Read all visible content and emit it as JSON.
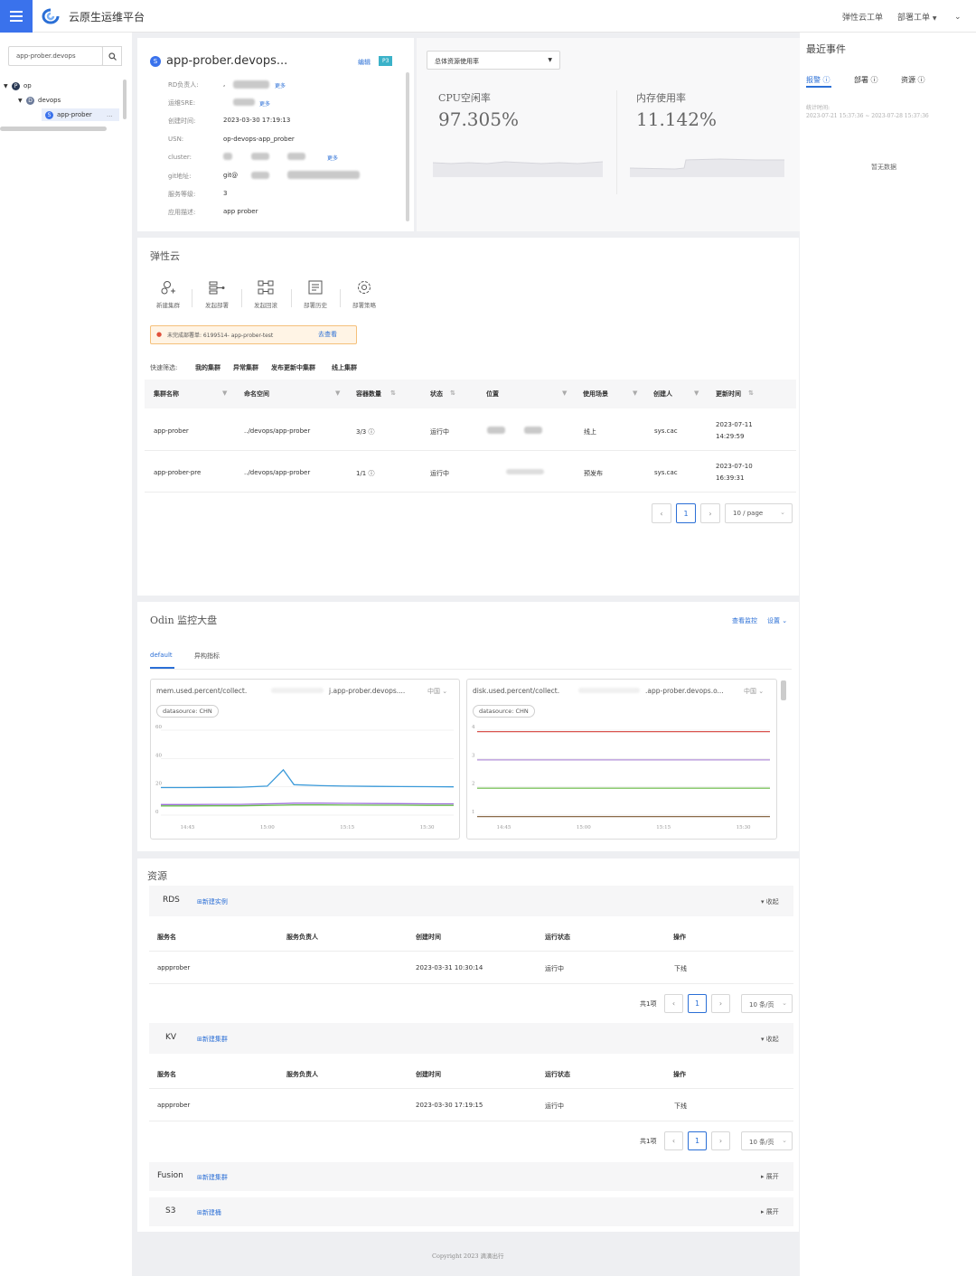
{
  "app": {
    "title": "云原生运维平台"
  },
  "topnav": {
    "elastic_ticket": "弹性云工单",
    "deploy_ticket": "部署工单"
  },
  "sidebar": {
    "search_value": "app-prober.devops",
    "tree": [
      {
        "badge": "P",
        "label": "op"
      },
      {
        "badge": "D",
        "label": "devops"
      },
      {
        "badge": "S",
        "label": "app-prober",
        "more": "..."
      }
    ]
  },
  "service": {
    "badge": "S",
    "name": "app-prober.devops...",
    "edit": "编辑",
    "level_tag": "P3",
    "more": "更多",
    "fields": [
      {
        "key": "RD负责人:",
        "value": ","
      },
      {
        "key": "运维SRE:",
        "value": ""
      },
      {
        "key": "创建时间:",
        "value": "2023-03-30 17:19:13"
      },
      {
        "key": "USN:",
        "value": "op-devops-app_prober"
      },
      {
        "key": "cluster:",
        "value": ""
      },
      {
        "key": "git地址:",
        "value": "git@"
      },
      {
        "key": "服务等级:",
        "value": "3"
      },
      {
        "key": "应用描述:",
        "value": "app prober"
      }
    ]
  },
  "usage": {
    "select": "总体资源使用率",
    "cpu_label": "CPU空闲率",
    "cpu_value": "97.305%",
    "mem_label": "内存使用率",
    "mem_value": "11.142%"
  },
  "events": {
    "title": "最近事件",
    "tabs": [
      "报警",
      "部署",
      "资源"
    ],
    "time_label": "统计时间:",
    "time_range": "2023-07-21 15:37:36 ~ 2023-07-28 15:37:36",
    "empty": "暂无数据"
  },
  "elastic": {
    "title": "弹性云",
    "actions": [
      "新建集群",
      "发起部署",
      "发起回滚",
      "部署历史",
      "部署策略"
    ],
    "alert_text": "未完成部署单: 6199514- app-prober-test",
    "alert_link": "去查看",
    "filter_label": "快速筛选:",
    "filters": [
      "我的集群",
      "异常集群",
      "发布更新中集群",
      "线上集群"
    ],
    "columns": [
      "集群名称",
      "命名空间",
      "容器数量",
      "状态",
      "位置",
      "使用场景",
      "创建人",
      "更新时间"
    ],
    "rows": [
      {
        "name": "app-prober",
        "ns": "../devops/app-prober",
        "count": "3/3",
        "status": "运行中",
        "scene": "线上",
        "creator": "sys.cac",
        "date": "2023-07-11",
        "time": "14:29:59"
      },
      {
        "name": "app-prober-pre",
        "ns": "../devops/app-prober",
        "count": "1/1",
        "status": "运行中",
        "scene": "预发布",
        "creator": "sys.cac",
        "date": "2023-07-10",
        "time": "16:39:31"
      }
    ],
    "page": "1",
    "page_size": "10 / page"
  },
  "odin": {
    "title": "Odin 监控大盘",
    "view_monitor": "查看监控",
    "settings": "设置",
    "tabs": [
      "default",
      "异构指标"
    ],
    "charts": [
      {
        "metric": "mem.used.percent/collect.",
        "metric_tail": "j.app-prober.devops....",
        "region": "中国",
        "datasource": "datasource: CHN",
        "yticks": [
          "60",
          "40",
          "20",
          "0"
        ],
        "xticks": [
          "14:45",
          "15:00",
          "15:15",
          "15:30"
        ]
      },
      {
        "metric": "disk.used.percent/collect.",
        "metric_tail": ".app-prober.devops.o...",
        "region": "中国",
        "datasource": "datasource: CHN",
        "yticks": [
          "4",
          "3",
          "2",
          "1"
        ],
        "xticks": [
          "14:45",
          "15:00",
          "15:15",
          "15:30"
        ]
      }
    ]
  },
  "chart_data": [
    {
      "type": "line",
      "x": [
        "14:40",
        "14:45",
        "14:50",
        "14:55",
        "15:00",
        "15:03",
        "15:05",
        "15:10",
        "15:15",
        "15:20",
        "15:25",
        "15:30",
        "15:35"
      ],
      "series": [
        {
          "values": [
            19.5,
            19.5,
            19.6,
            19.7,
            20.5,
            32,
            21.5,
            20.8,
            20.5,
            20.3,
            20.2,
            20.1,
            20.0
          ],
          "color": "#3b9ad9"
        },
        {
          "values": [
            7.5,
            7.5,
            7.6,
            7.6,
            8.0,
            8.2,
            8.4,
            8.4,
            8.3,
            8.2,
            8.1,
            8.0,
            8.0
          ],
          "color": "#9b6fd8"
        },
        {
          "values": [
            6.5,
            6.5,
            6.6,
            6.6,
            6.9,
            7.0,
            7.2,
            7.2,
            7.1,
            7.0,
            7.0,
            6.9,
            6.9
          ],
          "color": "#6bbf4e"
        }
      ],
      "ylim": [
        0,
        60
      ]
    },
    {
      "type": "line",
      "x": [
        "14:40",
        "14:45",
        "15:00",
        "15:15",
        "15:30",
        "15:35"
      ],
      "series": [
        {
          "values": [
            3.95,
            3.95,
            3.95,
            3.95,
            3.95,
            3.95
          ],
          "color": "#d9534f"
        },
        {
          "values": [
            2.95,
            2.95,
            2.95,
            2.95,
            2.95,
            2.95
          ],
          "color": "#b28fd9"
        },
        {
          "values": [
            1.95,
            1.95,
            1.95,
            1.95,
            1.95,
            1.95
          ],
          "color": "#7dc35e"
        },
        {
          "values": [
            0.95,
            0.95,
            0.95,
            0.95,
            0.95,
            0.95
          ],
          "color": "#8b6b4a"
        }
      ],
      "ylim": [
        1,
        4
      ]
    }
  ],
  "resources": {
    "title": "资源",
    "columns": [
      "服务名",
      "服务负责人",
      "创建时间",
      "运行状态",
      "操作"
    ],
    "rds": {
      "label": "RDS",
      "add": "新建实例",
      "toggle": "收起",
      "row": {
        "name": "appprober",
        "created": "2023-03-31 10:30:14",
        "status": "运行中",
        "op": "下线"
      },
      "total": "共1项",
      "page": "1",
      "page_size": "10 条/页"
    },
    "kv": {
      "label": "KV",
      "add": "新建集群",
      "toggle": "收起",
      "row": {
        "name": "appprober",
        "created": "2023-03-30 17:19:15",
        "status": "运行中",
        "op": "下线"
      },
      "total": "共1项",
      "page": "1",
      "page_size": "10 条/页"
    },
    "fusion": {
      "label": "Fusion",
      "add": "新建集群",
      "toggle": "展开"
    },
    "s3": {
      "label": "S3",
      "add": "新建桶",
      "toggle": "展开"
    }
  },
  "footer": {
    "copyright": "Copyright 2023 滴滴出行"
  }
}
